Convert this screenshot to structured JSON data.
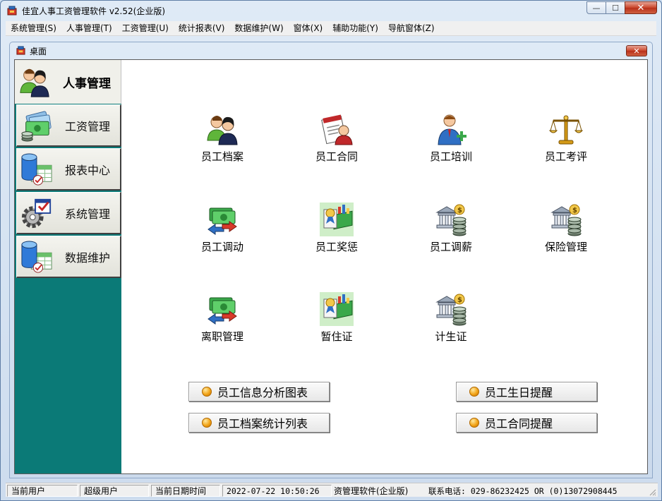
{
  "window": {
    "title": "佳宜人事工资管理软件 v2.52(企业版)",
    "buttons": {
      "minimize": "—",
      "maximize": "☐",
      "close": "✕"
    }
  },
  "menu": [
    "系统管理(S)",
    "人事管理(T)",
    "工资管理(U)",
    "统计报表(V)",
    "数据维护(W)",
    "窗体(X)",
    "辅助功能(Y)",
    "导航窗体(Z)"
  ],
  "child_window": {
    "title": "桌面",
    "close": "✕"
  },
  "nav": {
    "active": {
      "label": "人事管理",
      "icon": "users-icon"
    },
    "items": [
      {
        "label": "工资管理",
        "icon": "money-icon"
      },
      {
        "label": "报表中心",
        "icon": "database-report-icon"
      },
      {
        "label": "系统管理",
        "icon": "settings-gear-icon"
      },
      {
        "label": "数据维护",
        "icon": "database-report-icon"
      }
    ]
  },
  "tiles": [
    {
      "label": "员工档案",
      "icon": "users-icon"
    },
    {
      "label": "员工合同",
      "icon": "contract-icon"
    },
    {
      "label": "员工培训",
      "icon": "user-add-icon"
    },
    {
      "label": "员工考评",
      "icon": "scales-icon"
    },
    {
      "label": "员工调动",
      "icon": "money-transfer-icon"
    },
    {
      "label": "员工奖惩",
      "icon": "award-icon"
    },
    {
      "label": "员工调薪",
      "icon": "bank-coins-icon"
    },
    {
      "label": "保险管理",
      "icon": "bank-coins-icon"
    },
    {
      "label": "离职管理",
      "icon": "money-transfer-icon"
    },
    {
      "label": "暂住证",
      "icon": "award-icon"
    },
    {
      "label": "计生证",
      "icon": "bank-coins-icon"
    }
  ],
  "report_buttons": [
    "员工信息分析图表",
    "员工生日提醒",
    "员工档案统计列表",
    "员工合同提醒"
  ],
  "status": {
    "user_label": "当前用户",
    "user_value": "超级用户",
    "date_label": "当前日期时间",
    "date_value": "2022-07-22 10:50:26",
    "edition": "资管理软件(企业版)",
    "contact": "联系电话: 029-86232425 OR (0)13072908445"
  },
  "colors": {
    "nav_bg": "#0b7a77",
    "desktop_bg": "#ffffff",
    "bullet": "#f2a418"
  }
}
